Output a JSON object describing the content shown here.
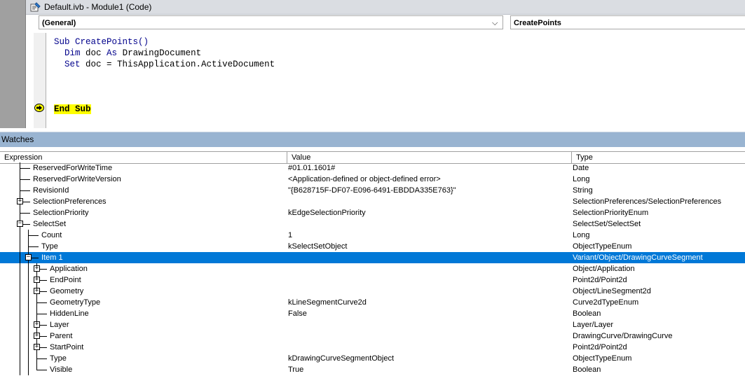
{
  "window": {
    "title": "Default.ivb - Module1 (Code)"
  },
  "object_combo": {
    "value": "(General)"
  },
  "proc_combo": {
    "value": "CreatePoints"
  },
  "code": {
    "line1": "Sub CreatePoints()",
    "line2a": "Dim",
    "line2b": " doc ",
    "line2c": "As",
    "line2d": " DrawingDocument",
    "line3a": "Set",
    "line3b": " doc = ThisApplication.ActiveDocument",
    "line4": "End Sub"
  },
  "watches": {
    "title": "Watches",
    "col_expression": "Expression",
    "col_value": "Value",
    "col_type": "Type",
    "rows": [
      {
        "expr": "ReservedForWriteTime",
        "value": "#01.01.1601#",
        "type": "Date"
      },
      {
        "expr": "ReservedForWriteVersion",
        "value": "<Application-defined or object-defined error>",
        "type": "Long"
      },
      {
        "expr": "RevisionId",
        "value": "\"{B628715F-DF07-E096-6491-EBDDA335E763}\"",
        "type": "String"
      },
      {
        "expr": "SelectionPreferences",
        "value": "",
        "type": "SelectionPreferences/SelectionPreferences"
      },
      {
        "expr": "SelectionPriority",
        "value": "kEdgeSelectionPriority",
        "type": "SelectionPriorityEnum"
      },
      {
        "expr": "SelectSet",
        "value": "",
        "type": "SelectSet/SelectSet"
      },
      {
        "expr": "Count",
        "value": "1",
        "type": "Long"
      },
      {
        "expr": "Type",
        "value": "kSelectSetObject",
        "type": "ObjectTypeEnum"
      },
      {
        "expr": "Item 1",
        "value": "",
        "type": "Variant/Object/DrawingCurveSegment"
      },
      {
        "expr": "Application",
        "value": "",
        "type": "Object/Application"
      },
      {
        "expr": "EndPoint",
        "value": "",
        "type": "Point2d/Point2d"
      },
      {
        "expr": "Geometry",
        "value": "",
        "type": "Object/LineSegment2d"
      },
      {
        "expr": "GeometryType",
        "value": "kLineSegmentCurve2d",
        "type": "Curve2dTypeEnum"
      },
      {
        "expr": "HiddenLine",
        "value": "False",
        "type": "Boolean"
      },
      {
        "expr": "Layer",
        "value": "",
        "type": "Layer/Layer"
      },
      {
        "expr": "Parent",
        "value": "",
        "type": "DrawingCurve/DrawingCurve"
      },
      {
        "expr": "StartPoint",
        "value": "",
        "type": "Point2d/Point2d"
      },
      {
        "expr": "Type",
        "value": "kDrawingCurveSegmentObject",
        "type": "ObjectTypeEnum"
      },
      {
        "expr": "Visible",
        "value": "True",
        "type": "Boolean"
      }
    ]
  }
}
